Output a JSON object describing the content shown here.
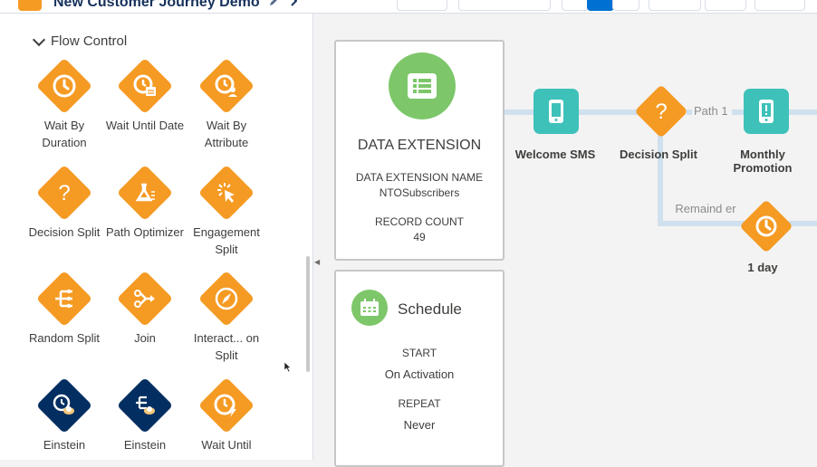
{
  "header": {
    "title": "New Customer Journey Demo",
    "icons": [
      "journey-badge-icon",
      "pencil-icon",
      "chevron-right-icon"
    ]
  },
  "palette": {
    "section_label": "Flow Control",
    "activities": [
      {
        "label": "Wait By Duration",
        "icon": "clock-icon",
        "color": "#f59a23"
      },
      {
        "label": "Wait Until Date",
        "icon": "calendar-clock-icon",
        "color": "#f59a23"
      },
      {
        "label": "Wait By Attribute",
        "icon": "person-clock-icon",
        "color": "#f59a23"
      },
      {
        "label": "Decision Split",
        "icon": "question-icon",
        "color": "#f59a23"
      },
      {
        "label": "Path Optimizer",
        "icon": "flask-icon",
        "color": "#f59a23"
      },
      {
        "label": "Engagement Split",
        "icon": "click-icon",
        "color": "#f59a23"
      },
      {
        "label": "Random Split",
        "icon": "split-icon",
        "color": "#f59a23"
      },
      {
        "label": "Join",
        "icon": "join-icon",
        "color": "#f59a23"
      },
      {
        "label": "Interact... on Split",
        "icon": "compass-icon",
        "color": "#f59a23"
      },
      {
        "label": "Einstein",
        "icon": "einstein-clock-icon",
        "color": "#032e61"
      },
      {
        "label": "Einstein",
        "icon": "einstein-split-icon",
        "color": "#032e61"
      },
      {
        "label": "Wait Until",
        "icon": "clock-bolt-icon",
        "color": "#f59a23"
      }
    ]
  },
  "entry_source": {
    "title": "DATA EXTENSION",
    "name_label": "DATA EXTENSION NAME",
    "name_value": "NTOSubscribers",
    "count_label": "RECORD COUNT",
    "count_value": "49"
  },
  "schedule": {
    "title": "Schedule",
    "start_label": "START",
    "start_value": "On Activation",
    "repeat_label": "REPEAT",
    "repeat_value": "Never"
  },
  "flow": {
    "nodes": [
      {
        "label": "Welcome SMS",
        "icon": "mobile-icon"
      },
      {
        "label": "Decision Split",
        "icon": "question-icon"
      },
      {
        "label": "Monthly Promotion",
        "icon": "mobile-alert-icon"
      },
      {
        "label": "1 day",
        "icon": "clock-icon"
      }
    ],
    "path_labels": [
      "Path 1",
      "Remaind er"
    ]
  },
  "colors": {
    "flow_orange": "#f59a23",
    "einstein_navy": "#032e61",
    "entry_green": "#7dc76a",
    "sms_teal": "#3ec1b9",
    "connector": "#cfe0ee"
  }
}
